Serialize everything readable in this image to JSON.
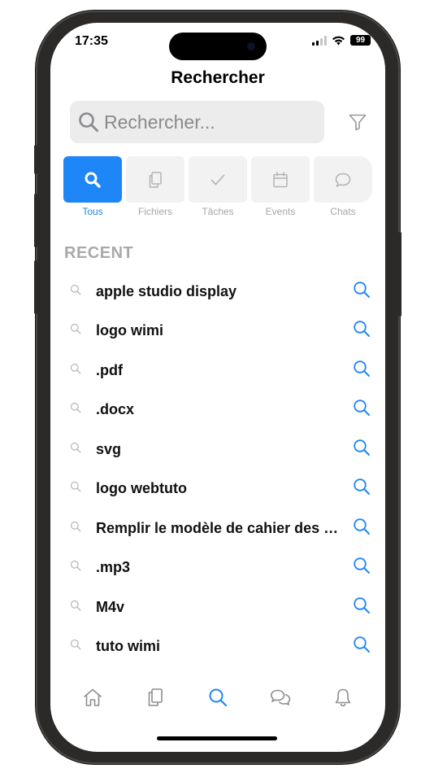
{
  "status_bar": {
    "time": "17:35",
    "battery": "99"
  },
  "header": {
    "title": "Rechercher"
  },
  "search": {
    "placeholder": "Rechercher...",
    "value": ""
  },
  "tabs": [
    {
      "label": "Tous",
      "icon": "search-icon",
      "active": true
    },
    {
      "label": "Fichiers",
      "icon": "files-icon",
      "active": false
    },
    {
      "label": "Tâches",
      "icon": "check-icon",
      "active": false
    },
    {
      "label": "Events",
      "icon": "calendar-icon",
      "active": false
    },
    {
      "label": "Chats",
      "icon": "chat-bubble-icon",
      "active": false
    }
  ],
  "recent": {
    "heading": "RECENT",
    "items": [
      "apple studio display",
      "logo wimi",
      ".pdf",
      ".docx",
      "svg",
      "logo webtuto",
      "Remplir le modèle de cahier des ch...",
      ".mp3",
      "M4v",
      "tuto wimi"
    ]
  },
  "bottom_nav": [
    {
      "name": "home",
      "icon": "home-icon",
      "active": false
    },
    {
      "name": "files",
      "icon": "files-icon",
      "active": false
    },
    {
      "name": "search",
      "icon": "search-icon",
      "active": true
    },
    {
      "name": "chats",
      "icon": "chat-bubbles-icon",
      "active": false
    },
    {
      "name": "notifications",
      "icon": "bell-icon",
      "active": false
    }
  ],
  "colors": {
    "accent": "#1e86f7",
    "muted": "#a6a6a6",
    "frame": "#2b2a28"
  }
}
